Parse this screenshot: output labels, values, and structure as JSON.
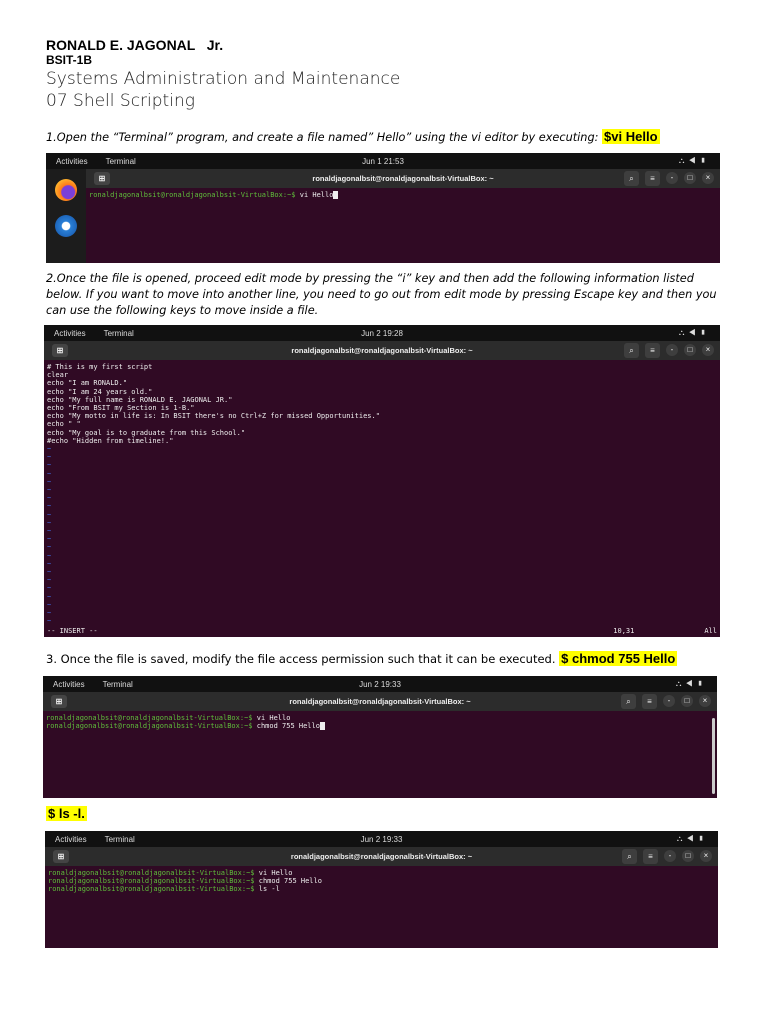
{
  "header": {
    "name": "RONALD E. JAGONAL   Jr.",
    "section": "BSIT-1B",
    "course": "Systems Administration and Maintenance",
    "topic": "07 Shell Scripting"
  },
  "steps": [
    {
      "text": "1.Open the “Terminal” program, and create a file named” Hello” using the vi editor by executing: ",
      "cmd": "$vi Hello"
    },
    {
      "text": "2.Once the file is opened, proceed edit mode by pressing the “i” key and then add the following information listed below. If you want to move into another line, you need to go out from edit mode by pressing Escape key and then you can use the following keys to move inside a file."
    },
    {
      "text": "3. Once the file is saved, modify the file access permission such that it can be executed. ",
      "cmd": "$ chmod 755 Hello"
    },
    {
      "cmd": "$ ls -l."
    }
  ],
  "ui": {
    "activities": "Activities",
    "app": "Terminal",
    "title": "ronaldjagonalbsit@ronaldjagonalbsit-VirtualBox: ~",
    "prompt": "ronaldjagonalbsit@ronaldjagonalbsit-VirtualBox:~$"
  },
  "terms": [
    {
      "clock": "Jun 1  21:53",
      "lines": [
        "vi Hello"
      ]
    },
    {
      "clock": "Jun 2  19:28",
      "script": [
        "# This is my first script",
        "clear",
        "echo \"I am RONALD.\"",
        "echo \"I am 24 years old.\"",
        "echo \"My full name is RONALD E. JAGONAL JR.\"",
        "echo \"From BSIT my Section is 1-B.\"",
        "echo \"My motto in life is: In BSIT there's no Ctrl+Z for missed Opportunities.\"",
        "echo \" \"",
        "echo \"My goal is to graduate from this School.\"",
        "#echo \"Hidden from timeline!.\""
      ],
      "mode": "-- INSERT --",
      "pos": "10,31",
      "scroll": "All"
    },
    {
      "clock": "Jun 2  19:33",
      "lines": [
        "vi Hello",
        "chmod 755 Hello"
      ]
    },
    {
      "clock": "Jun 2  19:33",
      "lines": [
        "vi Hello",
        "chmod 755 Hello",
        "ls -l"
      ]
    }
  ]
}
